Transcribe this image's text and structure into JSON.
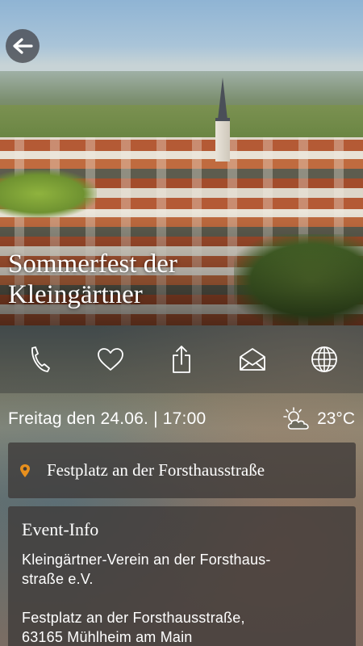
{
  "event": {
    "title_line1": "Sommerfest der",
    "title_line2": "Kleingärtner"
  },
  "actions": [
    {
      "icon": "phone-icon"
    },
    {
      "icon": "heart-icon"
    },
    {
      "icon": "share-icon"
    },
    {
      "icon": "mail-icon"
    },
    {
      "icon": "globe-icon"
    }
  ],
  "schedule": {
    "date_time": "Freitag den 24.06. | 17:00",
    "weather_icon": "partly-cloudy-icon",
    "temperature": "23°C"
  },
  "location": {
    "icon": "map-pin-icon",
    "name": "Festplatz an der Forsthausstraße",
    "pin_color": "#e8901e"
  },
  "info": {
    "heading": "Event-Info",
    "organizer_line1": "Kleingärtner-Verein an der Forsthaus-",
    "organizer_line2": "straße e.V.",
    "address_line1": "Festplatz an der Forsthausstraße,",
    "address_line2": "63165 Mühlheim am Main"
  }
}
